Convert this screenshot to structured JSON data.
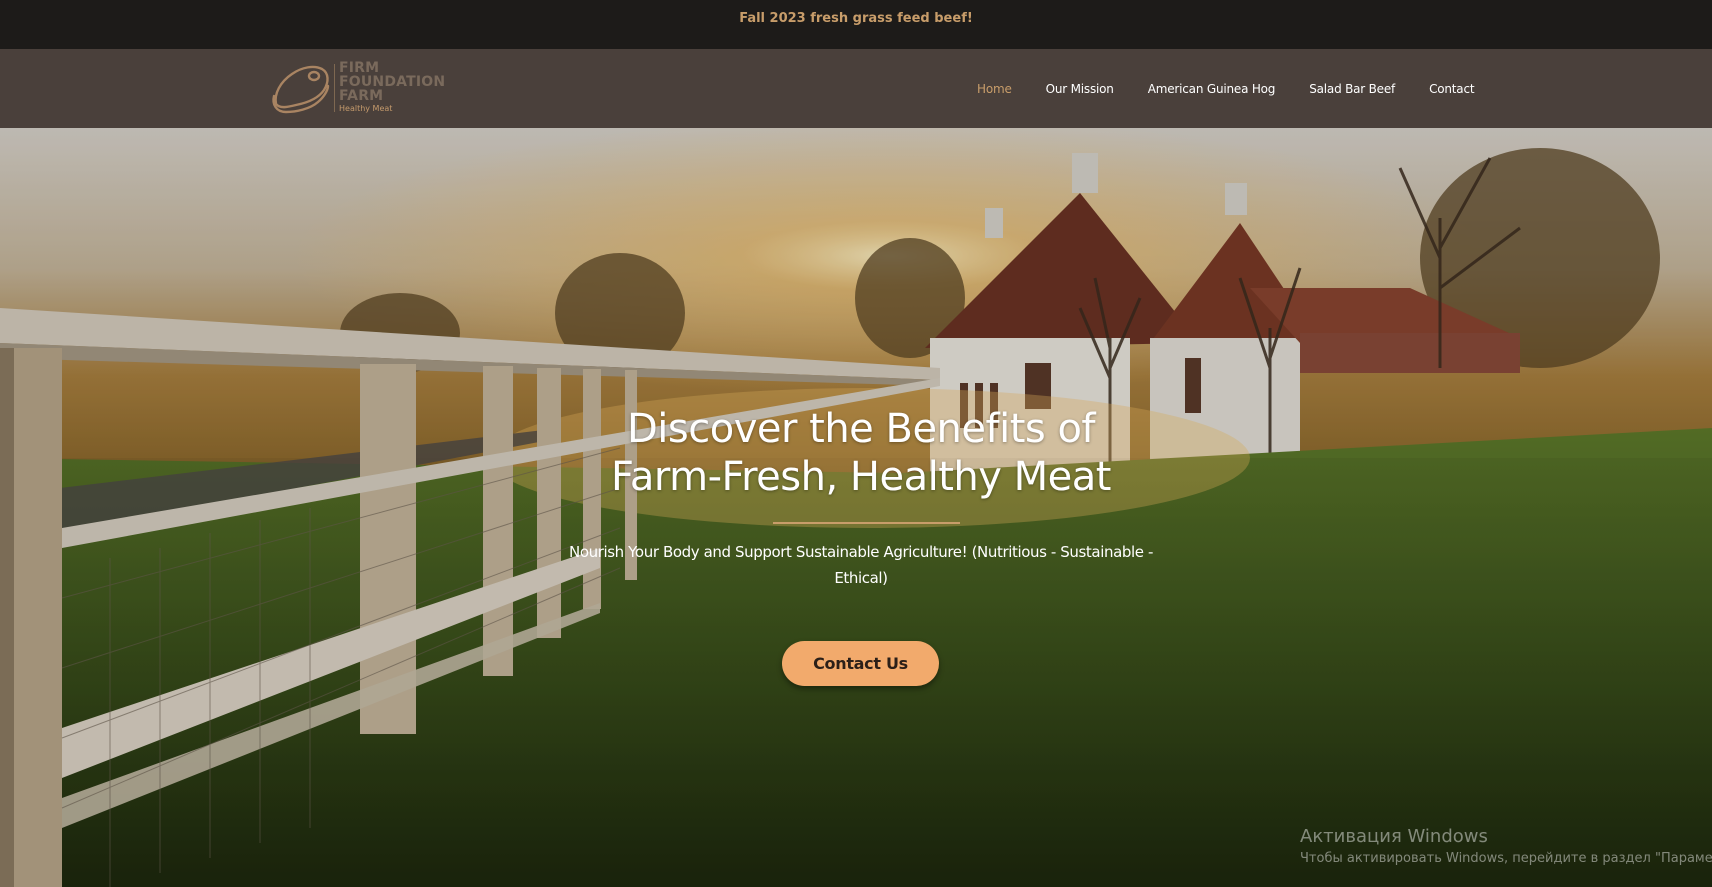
{
  "announcement": {
    "text": "Fall 2023 fresh grass feed beef!"
  },
  "header": {
    "logo": {
      "line1": "FIRM",
      "line2": "FOUNDATION",
      "line3": "FARM",
      "tagline": "Healthy Meat",
      "icon": "steak-icon"
    },
    "nav": [
      {
        "label": "Home",
        "active": true
      },
      {
        "label": "Our Mission",
        "active": false
      },
      {
        "label": "American Guinea Hog",
        "active": false
      },
      {
        "label": "Salad Bar Beef",
        "active": false
      },
      {
        "label": "Contact",
        "active": false
      }
    ]
  },
  "hero": {
    "title_line1": "Discover the Benefits of",
    "title_line2": "Farm-Fresh, Healthy Meat",
    "subtitle": "Nourish Your Body and Support Sustainable Agriculture! (Nutritious - Sustainable - Ethical)",
    "cta_label": "Contact Us",
    "background": "farmhouse-sunset-field-photo"
  },
  "system_overlay": {
    "title": "Активация Windows",
    "subtitle": "Чтобы активировать Windows, перейдите в раздел \"Параметры\"."
  },
  "colors": {
    "accent": "#c89d6a",
    "button": "#f2aa6c",
    "nav_bg": "#4a403b",
    "top_bar_bg": "#1d1b19"
  }
}
